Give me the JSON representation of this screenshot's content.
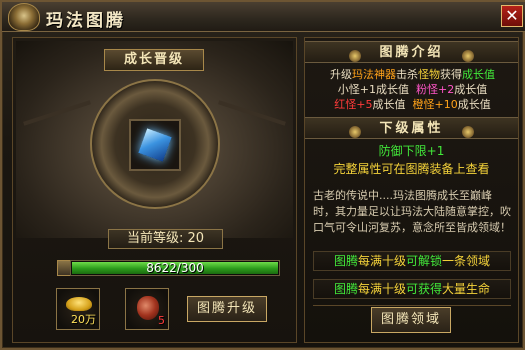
{
  "window": {
    "title": "玛法图腾",
    "close_label": "✕"
  },
  "left": {
    "level_header": "成长晋级",
    "current_level": "当前等级: 20",
    "exp": {
      "current": 8622,
      "max": 300,
      "text": "8622/300",
      "fill_fraction": 1.0
    },
    "gold_count": "20万",
    "heart_count": "5",
    "upgrade_button": "图腾升级"
  },
  "right": {
    "intro_header": "图腾介绍",
    "intro_line1": {
      "a": "升级",
      "b": "玛法神器",
      "c": "击杀",
      "d": "怪物",
      "e": "获得",
      "f": "成长值"
    },
    "intro_line2": {
      "a": "小怪+1成长值",
      "b": "粉怪+2",
      "c": "成长值"
    },
    "intro_line3": {
      "a": "红怪+5",
      "b": "成长值",
      "c": "橙怪+10",
      "d": "成长值"
    },
    "attr_header": "下级属性",
    "attr_value": "防御下限+1",
    "attr_note": "完整属性可在图腾装备上查看",
    "lore": "古老的传说中....玛法图腾成长至巅峰时，其力量足以让玛法大陆随意掌控，吹口气可令山河复苏，意念所至皆成领域！",
    "unlock1": {
      "a": "图腾",
      "b": "每满十级",
      "c": "可解锁",
      "d": "一条领域"
    },
    "unlock2": {
      "a": "图腾",
      "b": "每满十级",
      "c": "可获得",
      "d": "大量生命"
    },
    "domain_button": "图腾领域"
  }
}
